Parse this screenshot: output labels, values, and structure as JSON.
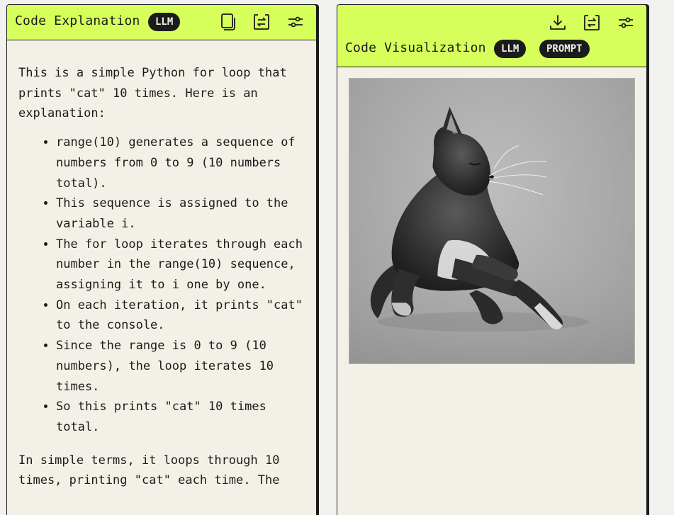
{
  "left_panel": {
    "title": "Code Explanation",
    "badge": "LLM",
    "icons": [
      "copy-icon",
      "swap-icon",
      "settings-sliders-icon"
    ],
    "intro": "This is a simple Python for loop that prints \"cat\" 10 times. Here is an explanation:",
    "bullets": [
      "range(10) generates a sequence of numbers from 0 to 9 (10 numbers total).",
      "This sequence is assigned to the variable i.",
      "The for loop iterates through each number in the range(10) sequence, assigning it to i one by one.",
      "On each iteration, it prints \"cat\" to the console.",
      "Since the range is 0 to 9 (10 numbers), the loop iterates 10 times.",
      "So this prints \"cat\" 10 times total."
    ],
    "outro": "In simple terms, it loops through 10 times, printing \"cat\" each time. The"
  },
  "right_panel": {
    "title": "Code Visualization",
    "badges": [
      "LLM",
      "PROMPT"
    ],
    "icons": [
      "download-icon",
      "swap-icon",
      "settings-sliders-icon"
    ],
    "image_alt": "cat"
  },
  "colors": {
    "header_bg": "#d6ff5c",
    "panel_bg": "#f3f1e7",
    "badge_bg": "#1b1b1b",
    "border": "#1b1b1b"
  }
}
